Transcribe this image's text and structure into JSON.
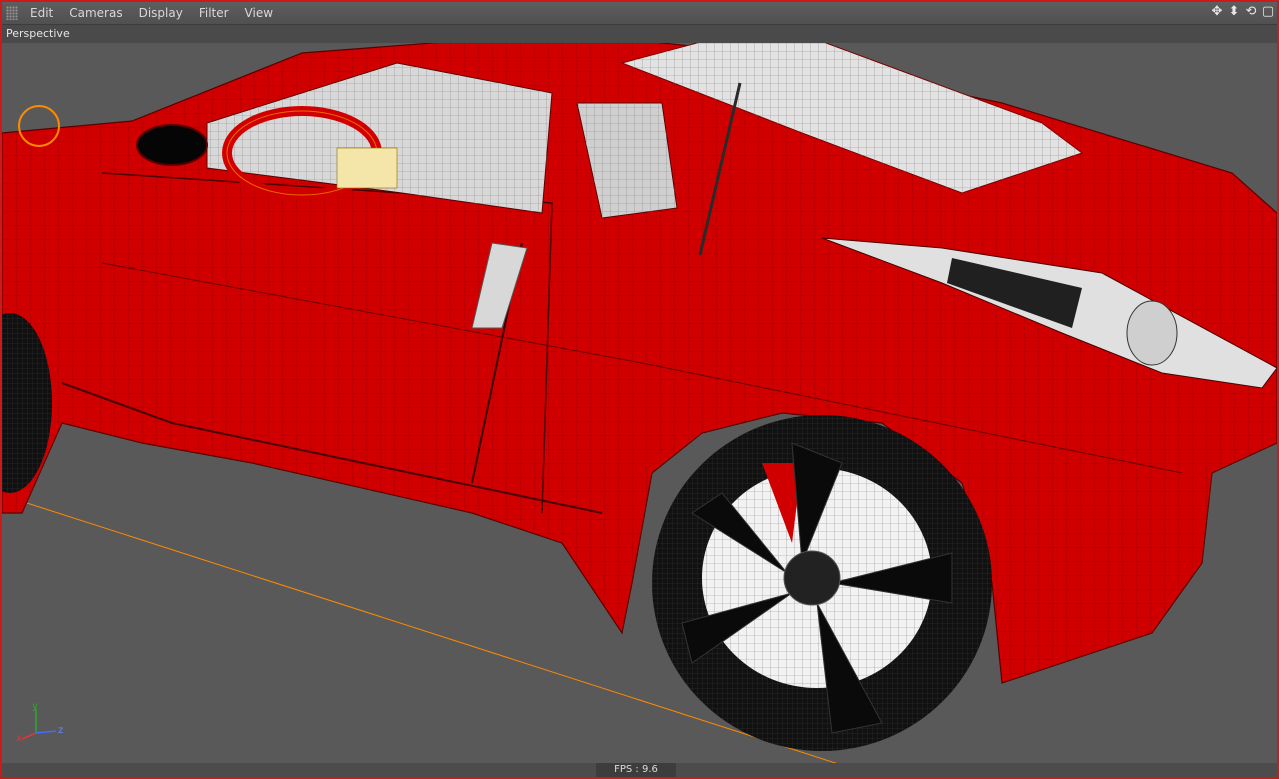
{
  "menubar": {
    "items": [
      "Edit",
      "Cameras",
      "Display",
      "Filter",
      "View"
    ],
    "nav_icons": [
      "move-icon",
      "dolly-icon",
      "rotate-icon",
      "maximize-icon"
    ]
  },
  "viewport": {
    "camera_label": "Perspective",
    "axis_labels": {
      "x": "x",
      "y": "y",
      "z": "z"
    },
    "model_color": "#d00000",
    "floor_line_color": "#ff8a00"
  },
  "status": {
    "fps": "FPS : 9.6"
  }
}
